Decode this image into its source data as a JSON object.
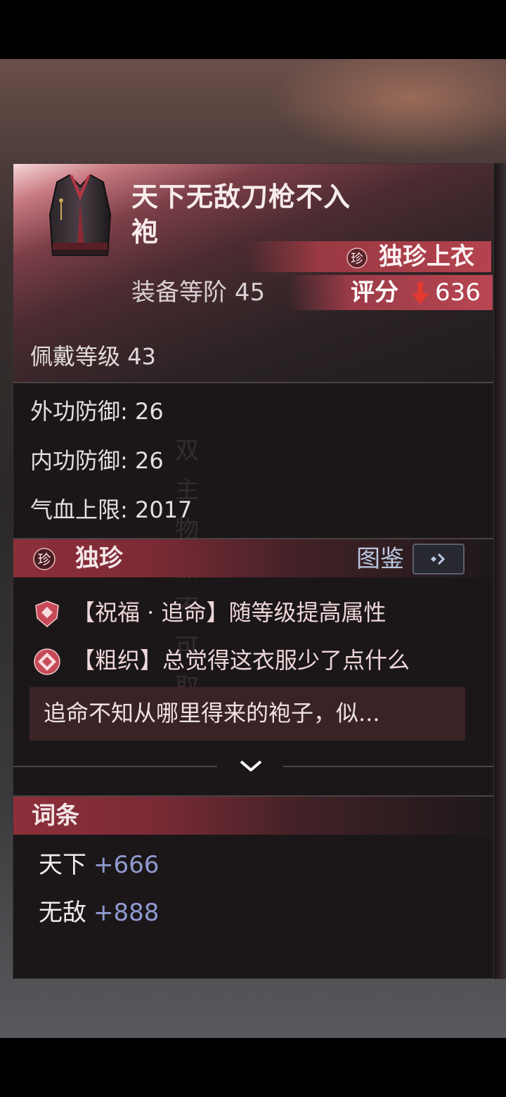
{
  "item": {
    "name": "天下无敌刀枪不入袍",
    "rarity_label": "独珍上衣",
    "rarity_icon": "zhen-rarity-icon",
    "tier_label": "装备等阶",
    "tier_value": "45",
    "score_label": "评分",
    "score_value": "636",
    "score_trend": "down",
    "wear_level_label": "佩戴等级",
    "wear_level_value": "43"
  },
  "stats": [
    {
      "label": "外功防御:",
      "value": "26"
    },
    {
      "label": "内功防御:",
      "value": "26"
    },
    {
      "label": "气血上限:",
      "value": "2017"
    }
  ],
  "seal_text": "双主物品不可取",
  "unique_section": {
    "title": "独珍",
    "atlas_label": "图鉴",
    "effects": [
      {
        "text": "【祝福 · 追命】随等级提高属性",
        "icon": "shield-icon"
      },
      {
        "text": "【粗织】总觉得这衣服少了点什么",
        "icon": "diamond-icon"
      }
    ],
    "description": "追命不知从哪里得来的袍子，似..."
  },
  "affix_section": {
    "title": "词条",
    "affixes": [
      {
        "name": "天下",
        "value": "+666"
      },
      {
        "name": "无敌",
        "value": "+888"
      }
    ]
  },
  "colors": {
    "accent_red": "#b4434f",
    "score_down": "#e23a2e",
    "affix_value": "#8f9ad0",
    "atlas_blue": "#b9c7e0"
  }
}
